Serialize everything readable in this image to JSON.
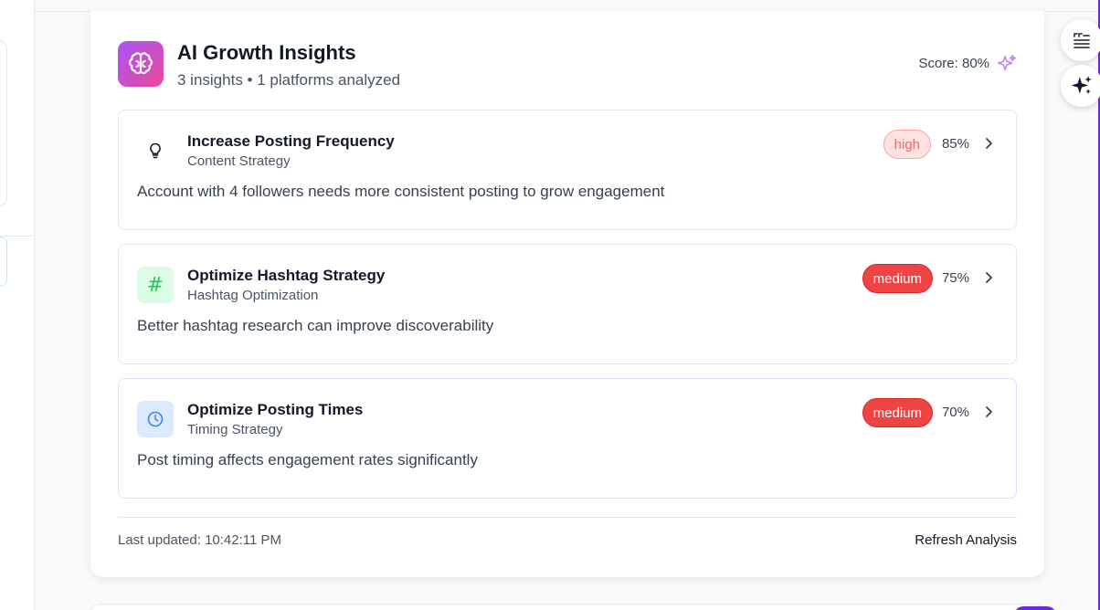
{
  "header": {
    "title": "AI Growth Insights",
    "subtitle": "3 insights • 1 platforms analyzed",
    "score": "Score: 80%"
  },
  "insights": [
    {
      "title": "Increase Posting Frequency",
      "category": "Content Strategy",
      "description": "Account with 4 followers needs more consistent posting to grow engagement",
      "priority": "high",
      "confidence": "85%",
      "icon": "lightbulb-icon"
    },
    {
      "title": "Optimize Hashtag Strategy",
      "category": "Hashtag Optimization",
      "description": "Better hashtag research can improve discoverability",
      "priority": "medium",
      "confidence": "75%",
      "icon": "hashtag-icon",
      "icon_glyph": "#"
    },
    {
      "title": "Optimize Posting Times",
      "category": "Timing Strategy",
      "description": "Post timing affects engagement rates significantly",
      "priority": "medium",
      "confidence": "70%",
      "icon": "clock-icon"
    }
  ],
  "footer": {
    "last_updated": "Last updated: 10:42:11 PM",
    "refresh_label": "Refresh Analysis"
  },
  "colors": {
    "brand_gradient_start": "#a855f7",
    "brand_gradient_end": "#ec4899",
    "high_badge_bg": "#fee2e2",
    "high_badge_text": "#ef6b6b",
    "medium_badge_bg": "#ef4444",
    "hashtag_tile_bg": "#dcfce7",
    "clock_tile_bg": "#dbeafe",
    "accent_purple": "#6d28d9"
  }
}
